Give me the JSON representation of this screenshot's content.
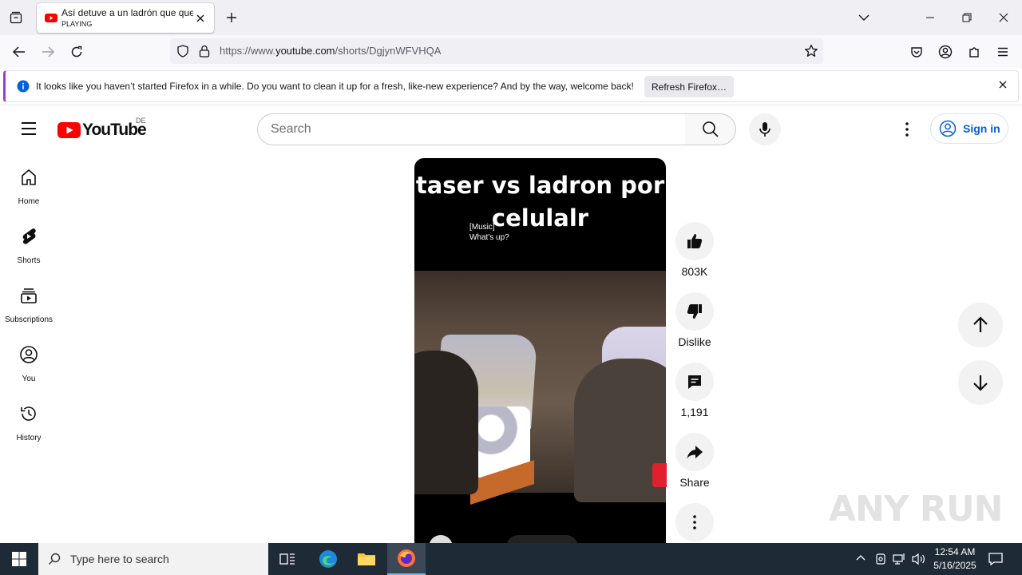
{
  "browser": {
    "tab": {
      "title": "Así detuve a un ladrón que quería robar",
      "subtitle": "PLAYING"
    },
    "url": {
      "prefix": "https://www.",
      "domain": "youtube.com",
      "path": "/shorts/DgjynWFVHQA"
    },
    "notification": {
      "message": "It looks like you haven’t started Firefox in a while. Do you want to clean it up for a fresh, like-new experience? And by the way, welcome back!",
      "button": "Refresh Firefox…"
    }
  },
  "youtube": {
    "logo": "YouTube",
    "country": "DE",
    "search_placeholder": "Search",
    "sign_in": "Sign in",
    "sidebar": [
      {
        "label": "Home",
        "icon": "home-icon"
      },
      {
        "label": "Shorts",
        "icon": "shorts-icon"
      },
      {
        "label": "Subscriptions",
        "icon": "subscriptions-icon"
      },
      {
        "label": "You",
        "icon": "you-icon"
      },
      {
        "label": "History",
        "icon": "history-icon"
      }
    ],
    "video": {
      "overlay_title": "taser vs ladron por celulalr",
      "caption_line1": "[Music]",
      "caption_line2": "What's up?"
    },
    "actions": {
      "likes": "803K",
      "dislike": "Dislike",
      "comments": "1,191",
      "share": "Share"
    },
    "watermark": "ANY RUN"
  },
  "taskbar": {
    "search_placeholder": "Type here to search",
    "time": "12:54 AM",
    "date": "5/16/2025"
  },
  "colors": {
    "youtube_red": "#ff0000",
    "signin_blue": "#065fd4",
    "taskbar": "#1f2a37"
  }
}
